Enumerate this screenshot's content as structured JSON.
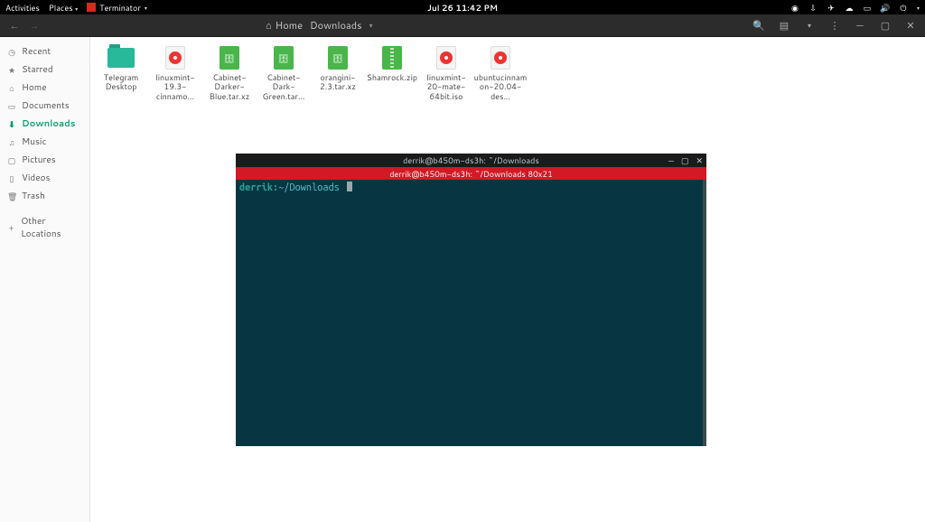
{
  "topbar": {
    "activities": "Activities",
    "places": "Places",
    "app_name": "Terminator",
    "clock": "Jul 26  11:42 PM"
  },
  "filemanager": {
    "path": {
      "home_label": "Home",
      "current_label": "Downloads"
    },
    "sidebar": [
      {
        "icon": "◷",
        "label": "Recent",
        "name": "sidebar-item-recent"
      },
      {
        "icon": "★",
        "label": "Starred",
        "name": "sidebar-item-starred"
      },
      {
        "icon": "⌂",
        "label": "Home",
        "name": "sidebar-item-home"
      },
      {
        "icon": "▭",
        "label": "Documents",
        "name": "sidebar-item-documents"
      },
      {
        "icon": "⬇",
        "label": "Downloads",
        "name": "sidebar-item-downloads",
        "active": true
      },
      {
        "icon": "♫",
        "label": "Music",
        "name": "sidebar-item-music"
      },
      {
        "icon": "▢",
        "label": "Pictures",
        "name": "sidebar-item-pictures"
      },
      {
        "icon": "▯",
        "label": "Videos",
        "name": "sidebar-item-videos"
      },
      {
        "icon": "🗑",
        "label": "Trash",
        "name": "sidebar-item-trash"
      }
    ],
    "other_locations": "Other Locations",
    "files": [
      {
        "type": "folder",
        "label": "Telegram Desktop"
      },
      {
        "type": "disc",
        "label": "linuxmint-19.3-cinnamo…"
      },
      {
        "type": "archive",
        "label": "Cabinet-Darker-Blue.tar.xz"
      },
      {
        "type": "archive",
        "label": "Cabinet-Dark-Green.tar…"
      },
      {
        "type": "archive",
        "label": "orangini-2.3.tar.xz"
      },
      {
        "type": "zip",
        "label": "Shamrock.zip"
      },
      {
        "type": "disc",
        "label": "linuxmint-20-mate-64bit.iso"
      },
      {
        "type": "disc",
        "label": "ubuntucinnamon-20.04-des…"
      }
    ]
  },
  "terminal": {
    "title": "derrik@b450m-ds3h: ~/Downloads",
    "tab_title": "derrik@b450m-ds3h: ~/Downloads 80x21",
    "prompt_user": "derrik:",
    "prompt_path": "~/Downloads"
  }
}
